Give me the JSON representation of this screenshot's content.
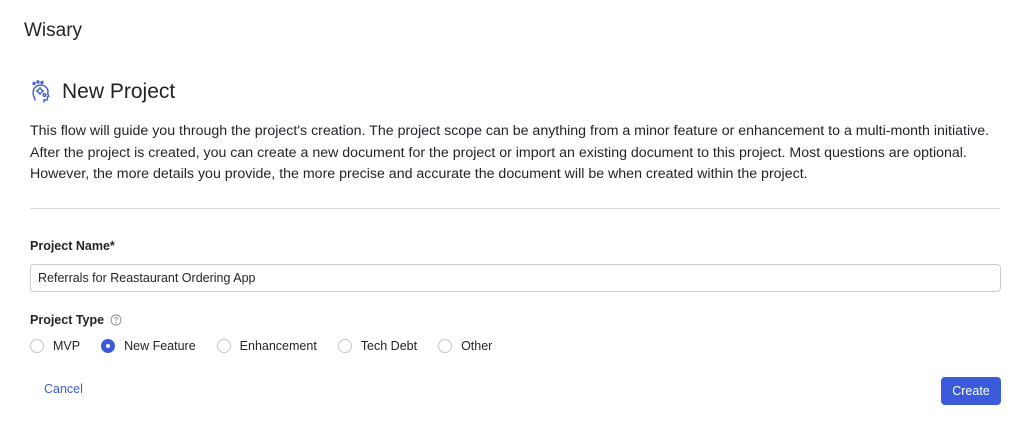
{
  "app": {
    "title": "Wisary"
  },
  "page": {
    "title": "New Project",
    "title_icon": "brain-gears-icon",
    "intro": "This flow will guide you through the project's creation. The project scope can be anything from a minor feature or enhancement to a multi-month initiative. After the project is created, you can create a new document for the project or import an existing document to this project. Most questions are optional. However, the more details you provide, the more precise and accurate the document will be when created within the project."
  },
  "form": {
    "name_label": "Project Name*",
    "name_value": "Referrals for Reastaurant Ordering App",
    "type_label": "Project Type",
    "type_help_icon": "question-circle-icon",
    "type_options": [
      {
        "label": "MVP",
        "checked": false
      },
      {
        "label": "New Feature",
        "checked": true
      },
      {
        "label": "Enhancement",
        "checked": false
      },
      {
        "label": "Tech Debt",
        "checked": false
      },
      {
        "label": "Other",
        "checked": false
      }
    ]
  },
  "actions": {
    "cancel_label": "Cancel",
    "create_label": "Create"
  },
  "colors": {
    "accent": "#3b5bdb",
    "text": "#1f2328",
    "divider": "#d9dce0"
  }
}
